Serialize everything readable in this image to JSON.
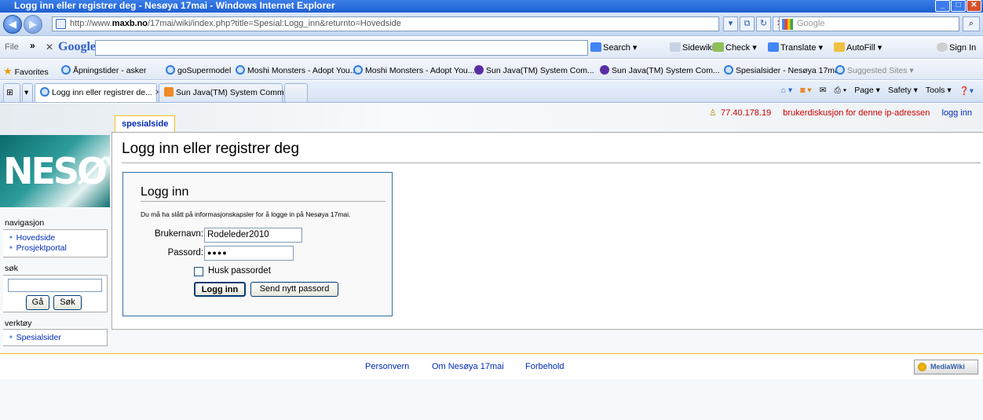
{
  "window": {
    "title": "Logg inn eller registrer deg - Nesøya 17mai - Windows Internet Explorer"
  },
  "address": {
    "url_prefix": "http://www.",
    "url_domain": "maxb.no",
    "url_path": "/17mai/wiki/index.php?title=Spesial:Logg_inn&returnto=Hovedside"
  },
  "search": {
    "placeholder": "Google"
  },
  "google_toolbar": {
    "file": "File",
    "logo": "Google",
    "items": [
      "Search",
      "Sidewiki",
      "Check",
      "Translate",
      "AutoFill",
      "Sign In"
    ]
  },
  "favorites": {
    "label": "Favorites",
    "items": [
      "Åpningstider - asker",
      "goSupermodel",
      "Moshi Monsters - Adopt You...",
      "Moshi Monsters - Adopt You...",
      "Sun Java(TM) System Com...",
      "Sun Java(TM) System Com...",
      "Spesialsider - Nesøya 17mai",
      "Suggested Sites"
    ]
  },
  "tabs": [
    {
      "label": "Logg inn eller registrer de..."
    },
    {
      "label": "Sun Java(TM) System Comm..."
    }
  ],
  "command_bar": [
    "Page",
    "Safety",
    "Tools"
  ],
  "personal": {
    "ip": "77.40.178.19",
    "talk": "brukerdiskusjon for denne ip-adressen",
    "login": "logg inn"
  },
  "logo_text": "NESØYA",
  "page_tab": "spesialside",
  "page_title": "Logg inn eller registrer deg",
  "login_form": {
    "heading": "Logg inn",
    "info": "Du må ha slått på informasjonskapsler for å logge in på Nesøya 17mai.",
    "username_label": "Brukernavn:",
    "username_value": "Rodeleder2010",
    "password_label": "Passord:",
    "password_value": "●●●●",
    "remember_label": "Husk passordet",
    "login_button": "Logg inn",
    "send_button": "Send nytt passord"
  },
  "sidebar": {
    "nav_heading": "navigasjon",
    "nav_items": [
      "Hovedside",
      "Prosjektportal"
    ],
    "search_heading": "søk",
    "go_button": "Gå",
    "search_button": "Søk",
    "tools_heading": "verktøy",
    "tools_items": [
      "Spesialsider"
    ]
  },
  "footer": {
    "links": [
      "Personvern",
      "Om Nesøya 17mai",
      "Forbehold"
    ],
    "badge": "MediaWiki"
  }
}
